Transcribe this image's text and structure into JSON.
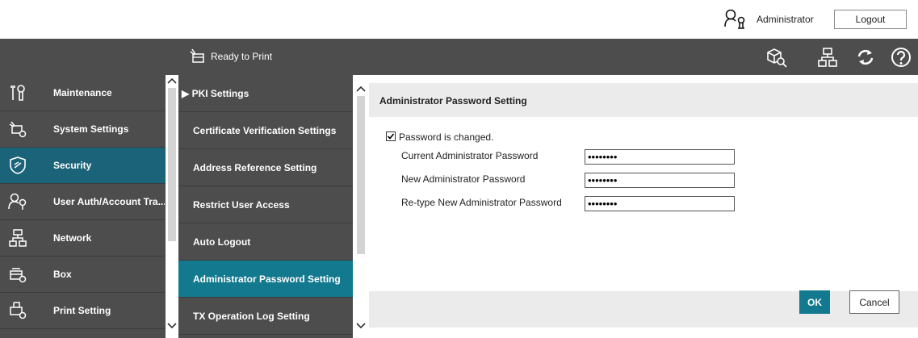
{
  "user": {
    "name": "Administrator",
    "icon": "user-admin-icon",
    "logout_label": "Logout"
  },
  "status": {
    "text": "Ready to Print",
    "icon": "printer-status-icon"
  },
  "toolbar_icons": [
    "search-device-icon",
    "network-icon",
    "refresh-icon",
    "help-icon"
  ],
  "left_nav": {
    "items": [
      {
        "label": "Maintenance",
        "icon": "maintenance-icon"
      },
      {
        "label": "System Settings",
        "icon": "system-settings-icon"
      },
      {
        "label": "Security",
        "icon": "shield-icon",
        "active": true
      },
      {
        "label": "User Auth/Account Tra...",
        "icon": "user-auth-icon"
      },
      {
        "label": "Network",
        "icon": "network-icon"
      },
      {
        "label": "Box",
        "icon": "box-icon"
      },
      {
        "label": "Print Setting",
        "icon": "print-setting-icon"
      }
    ]
  },
  "sub_nav": {
    "items": [
      {
        "label": "▶ PKI Settings"
      },
      {
        "label": "Certificate Verification Settings"
      },
      {
        "label": "Address Reference Setting"
      },
      {
        "label": "Restrict User Access"
      },
      {
        "label": "Auto Logout"
      },
      {
        "label": "Administrator Password Setting",
        "active": true
      },
      {
        "label": "TX Operation Log Setting"
      }
    ]
  },
  "main": {
    "title": "Administrator Password Setting",
    "checkbox_label": "Password is changed.",
    "checkbox_checked": true,
    "fields": [
      {
        "label": "Current Administrator Password",
        "value": "••••••••"
      },
      {
        "label": "New Administrator Password",
        "value": "••••••••"
      },
      {
        "label": "Re-type New Administrator Password",
        "value": "••••••••"
      }
    ],
    "ok_label": "OK",
    "cancel_label": "Cancel"
  },
  "colors": {
    "accent": "#13798f",
    "active_nav": "#1a6378",
    "nav_bg": "#4d4d4d"
  }
}
